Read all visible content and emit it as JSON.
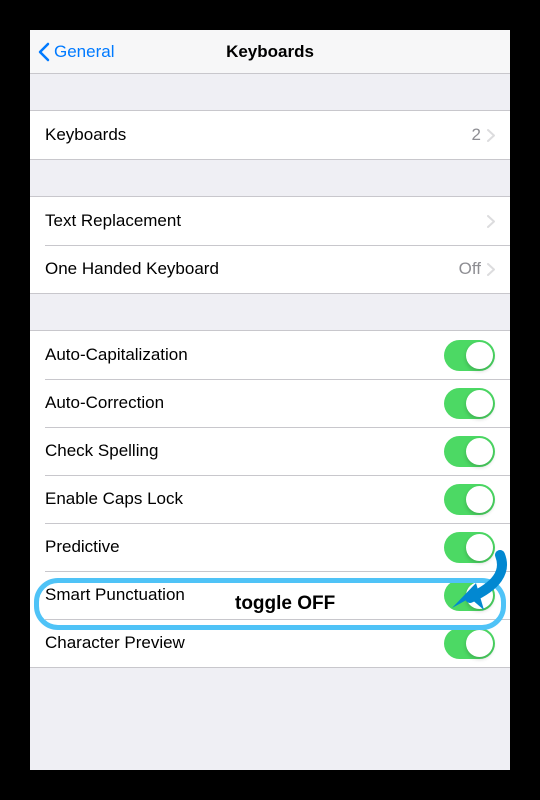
{
  "nav": {
    "back_label": "General",
    "title": "Keyboards"
  },
  "section1": {
    "keyboards_label": "Keyboards",
    "keyboards_count": "2"
  },
  "section2": {
    "text_replacement_label": "Text Replacement",
    "one_handed_label": "One Handed Keyboard",
    "one_handed_value": "Off"
  },
  "section3": {
    "auto_cap_label": "Auto-Capitalization",
    "auto_correct_label": "Auto-Correction",
    "check_spelling_label": "Check Spelling",
    "caps_lock_label": "Enable Caps Lock",
    "predictive_label": "Predictive",
    "smart_punct_label": "Smart Punctuation",
    "char_preview_label": "Character Preview"
  },
  "annotation": {
    "text": "toggle OFF"
  },
  "colors": {
    "accent": "#007aff",
    "toggle_on": "#4cd964",
    "highlight": "#4FC3F7",
    "arrow": "#0288D1"
  }
}
